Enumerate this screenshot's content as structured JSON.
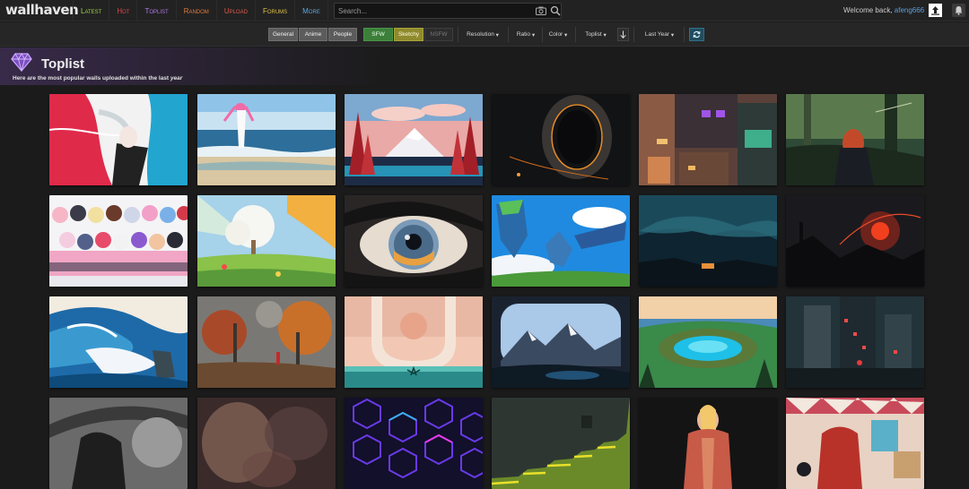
{
  "logo": "wallhaven",
  "nav": [
    {
      "label": "Latest",
      "color": "#9dd247"
    },
    {
      "label": "Hot",
      "color": "#e0424a"
    },
    {
      "label": "Toplist",
      "color": "#b07ae8"
    },
    {
      "label": "Random",
      "color": "#e07a3c"
    },
    {
      "label": "Upload",
      "color": "#e05a4a"
    },
    {
      "label": "Forums",
      "color": "#e0c04a"
    },
    {
      "label": "More",
      "color": "#5aa8e0"
    }
  ],
  "search": {
    "placeholder": "Search..."
  },
  "user": {
    "welcome": "Welcome back, ",
    "username": "afeng666"
  },
  "filters": {
    "categories": [
      "General",
      "Anime",
      "People"
    ],
    "purity": [
      "SFW",
      "Sketchy",
      "NSFW"
    ],
    "resolution": "Resolution",
    "ratio": "Ratio",
    "color": "Color",
    "sorting": "Toplist",
    "range": "Last Year"
  },
  "header": {
    "title": "Toplist",
    "subtitle_pre": "Here are the most popular walls uploaded within the last ",
    "subtitle_em": "year"
  },
  "colors": {
    "accent": "#b07ae8",
    "sfw": "#3c7f3a",
    "sketchy": "#8f8a2c"
  }
}
